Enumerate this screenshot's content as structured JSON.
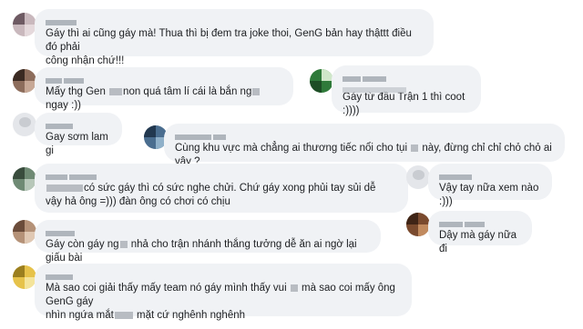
{
  "comments": [
    {
      "id": "c1",
      "text_parts": [
        "Gáy thì ai cũng gáy mà! Thua thì bị đem tra joke thoi, GenG bản hay thậttt điều đó phải\ncông nhận chứ!!!"
      ]
    },
    {
      "id": "c2",
      "text_parts": [
        "Mấy thg Gen",
        "non quá tâm lí cái là bắn ng",
        "ngay :))"
      ]
    },
    {
      "id": "c3",
      "text_parts": [
        "Gáy từ đầu Trận 1 thì coot :))))"
      ]
    },
    {
      "id": "c4",
      "text_parts": [
        "Gay sơm lam gi"
      ]
    },
    {
      "id": "c5",
      "text_parts": [
        "Cùng khu vực mà chẳng ai thương tiếc nổi cho tụi",
        "này, đừng chỉ chỉ chỏ chỏ ai vậy ?"
      ]
    },
    {
      "id": "c6",
      "text_parts": [
        "",
        "có sức gáy thì có sức nghe chửi. Chứ gáy xong phủi tay sủi dễ\nvậy hả ông =))) đàn ông có chơi có chịu"
      ]
    },
    {
      "id": "c7",
      "text_parts": [
        "Vậy tay nữa xem nào :)))"
      ]
    },
    {
      "id": "c8",
      "text_parts": [
        "Dậy mà gáy nữa đi"
      ]
    },
    {
      "id": "c9",
      "text_parts": [
        "Gáy còn gáy ng",
        "nhả cho trận nhánh thắng tưởng dễ ăn ai ngờ lại giấu bài"
      ]
    },
    {
      "id": "c10",
      "text_parts": [
        "Mà sao coi giải thấy mấy team nó gáy mình thấy vui",
        "mà sao coi mấy ông GenG gáy\nnhìn ngứa mắt",
        "mặt cứ nghênh nghênh"
      ]
    }
  ]
}
